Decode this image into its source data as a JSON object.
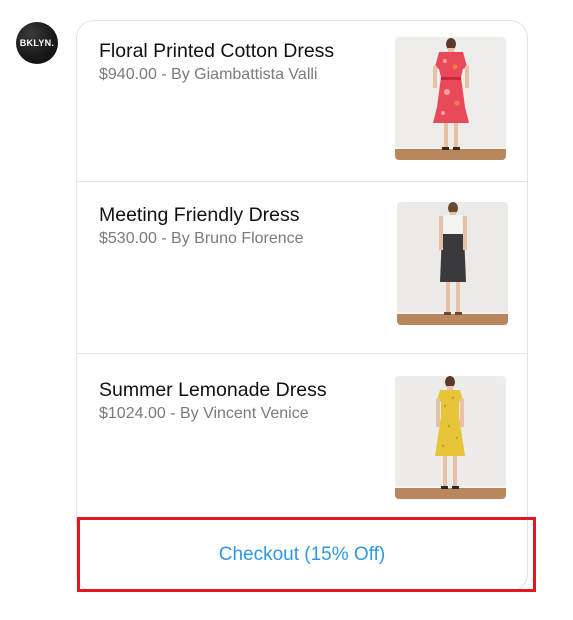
{
  "avatar": {
    "label": "BKLYN."
  },
  "items": [
    {
      "title": "Floral Printed Cotton Dress",
      "subtitle": "$940.00 - By Giambattista Valli",
      "image_icon": "dress-photo-floral-red",
      "dress_color": "#e84a5a"
    },
    {
      "title": "Meeting Friendly Dress",
      "subtitle": "$530.00 - By Bruno Florence",
      "image_icon": "dress-photo-black-white",
      "dress_color": "#3a3a3e"
    },
    {
      "title": "Summer Lemonade Dress",
      "subtitle": "$1024.00 - By Vincent Venice",
      "image_icon": "dress-photo-yellow",
      "dress_color": "#e8c43a"
    }
  ],
  "checkout": {
    "label": "Checkout (15% Off)",
    "color": "#2f96e8"
  },
  "highlight": {
    "color": "#e0191e"
  }
}
